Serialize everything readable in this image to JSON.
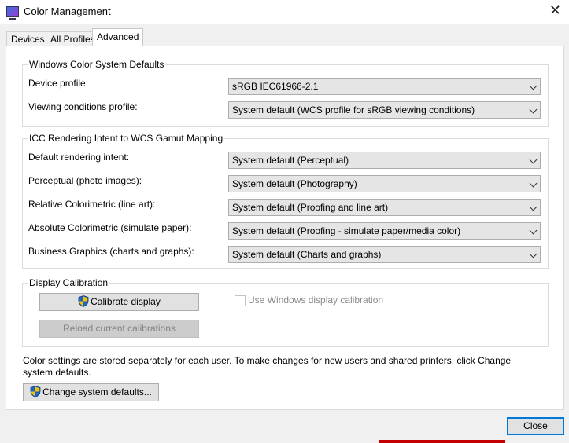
{
  "window": {
    "title": "Color Management",
    "close_glyph": "✕"
  },
  "tabs": [
    {
      "label": "Devices"
    },
    {
      "label": "All Profiles"
    },
    {
      "label": "Advanced"
    }
  ],
  "wcs_defaults": {
    "title": "Windows Color System Defaults",
    "device_profile": {
      "label": "Device profile:",
      "value": "sRGB IEC61966-2.1"
    },
    "viewing_conditions": {
      "label": "Viewing conditions profile:",
      "value": "System default (WCS profile for sRGB viewing conditions)"
    }
  },
  "icc_mapping": {
    "title": "ICC Rendering Intent to WCS Gamut Mapping",
    "rows": [
      {
        "label": "Default rendering intent:",
        "value": "System default (Perceptual)"
      },
      {
        "label": "Perceptual (photo images):",
        "value": "System default (Photography)"
      },
      {
        "label": "Relative Colorimetric (line art):",
        "value": "System default (Proofing and line art)"
      },
      {
        "label": "Absolute Colorimetric (simulate paper):",
        "value": "System default (Proofing - simulate paper/media color)"
      },
      {
        "label": "Business Graphics (charts and graphs):",
        "value": "System default (Charts and graphs)"
      }
    ]
  },
  "display_calibration": {
    "title": "Display Calibration",
    "calibrate_button": "Calibrate display",
    "reload_button": "Reload current calibrations",
    "use_windows_calibration": "Use Windows display calibration"
  },
  "info_text": "Color settings are stored separately for each user. To make changes for new users and shared printers, click Change system defaults.",
  "change_defaults_button": "Change system defaults...",
  "close_button": "Close",
  "colors": {
    "accent": "#0078d7",
    "panel": "#ffffff",
    "window": "#f0f0f0"
  }
}
